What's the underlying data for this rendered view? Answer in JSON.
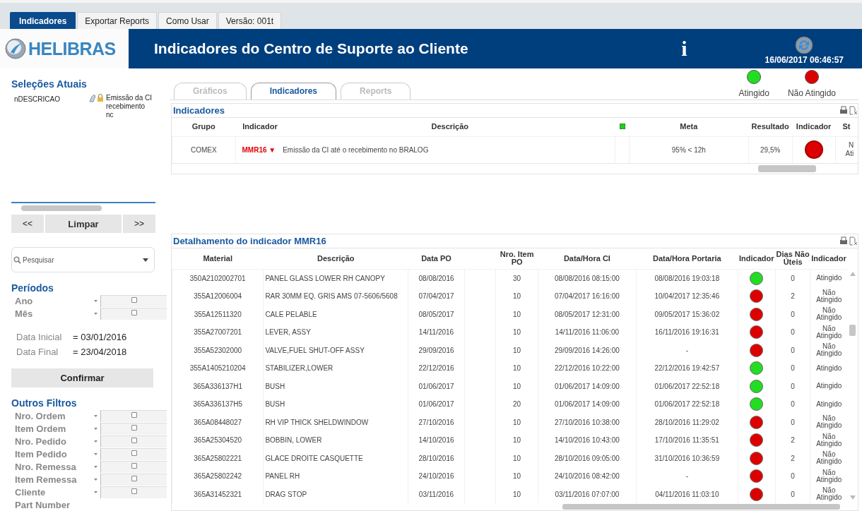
{
  "top_tabs": [
    {
      "label": "Indicadores",
      "selected": true
    },
    {
      "label": "Exportar Reports",
      "selected": false
    },
    {
      "label": "Como Usar",
      "selected": false
    },
    {
      "label": "Versão: 001t",
      "selected": false
    }
  ],
  "header": {
    "logo": "HELIBRAS",
    "title": "Indicadores do Centro de Suporte ao Cliente",
    "info": "i",
    "timestamp": "16/06/2017 06:46:57"
  },
  "sidebar": {
    "current_selections": {
      "title": "Seleções Atuais",
      "items": [
        {
          "field": "nDESCRICAO",
          "value": "Emissão da CI recebimento nc"
        }
      ]
    },
    "nav_buttons": [
      "<<",
      "Limpar",
      ">>"
    ],
    "search": {
      "placeholder": "Pesquisar"
    },
    "periods": {
      "title": "Períodos",
      "fields": [
        "Ano",
        "Mês"
      ]
    },
    "dates": [
      {
        "label": "Data Inicial",
        "value": "= 03/01/2016"
      },
      {
        "label": "Data Final",
        "value": "= 23/04/2018"
      }
    ],
    "confirm": "Confirmar",
    "other_filters": {
      "title": "Outros Filtros",
      "fields": [
        "Nro. Ordem",
        "Item Ordem",
        "Nro. Pedido",
        "Item Pedido",
        "Nro. Remessa",
        "Item Remessa",
        "Cliente"
      ],
      "trailing_label": "Part Number"
    }
  },
  "sub_tabs": [
    {
      "label": "Gráficos",
      "selected": false
    },
    {
      "label": "Indicadores",
      "selected": true
    },
    {
      "label": "Reports",
      "selected": false
    }
  ],
  "legend": [
    {
      "label": "Atingido",
      "color": "#22dd22"
    },
    {
      "label": "Não Atingido",
      "color": "#dd0000"
    }
  ],
  "indicators_table": {
    "title": "Indicadores",
    "columns": [
      {
        "kind": "text",
        "label": "Grupo"
      },
      {
        "kind": "text",
        "label": "Indicador"
      },
      {
        "kind": "text",
        "label": "Descrição"
      },
      {
        "kind": "marker",
        "color": "#22cc22"
      },
      {
        "kind": "text",
        "label": "Meta"
      },
      {
        "kind": "text",
        "label": "Resultado"
      },
      {
        "kind": "text",
        "label": "Indicador"
      },
      {
        "kind": "text",
        "label": "St"
      }
    ],
    "rows": [
      {
        "grupo": "COMEX",
        "indicador": "MMR16",
        "trend": "▼",
        "descricao": "Emissão da CI até o recebimento no BRALOG",
        "meta": "95% < 12h",
        "resultado": "29,5%",
        "color": "#dd0000",
        "status": "N Ati"
      }
    ]
  },
  "detail_table": {
    "title": "Detalhamento do indicador MMR16",
    "columns": [
      "Material",
      "Descrição",
      "Data PO",
      "Nro. Item PO",
      "Data/Hora CI",
      "Data/Hora Portaria",
      "Indicador",
      "Dias Não Úteis",
      "Indicador"
    ],
    "rows": [
      {
        "material": "350A2102002701",
        "descricao": "PANEL GLASS LOWER RH CANOPY",
        "data_po": "08/08/2016",
        "item_po": "30",
        "data_ci": "08/08/2016 08:15:00",
        "data_portaria": "08/08/2016 19:03:18",
        "color": "#22dd22",
        "dias": "0",
        "status": "Atingido"
      },
      {
        "material": "355A12006004",
        "descricao": "RAR 30MM EQ. GRIS AMS 07-5606/5608",
        "data_po": "07/04/2017",
        "item_po": "10",
        "data_ci": "07/04/2017 16:16:00",
        "data_portaria": "10/04/2017 12:35:46",
        "color": "#dd0000",
        "dias": "2",
        "status": "Não Atingido"
      },
      {
        "material": "355A12511320",
        "descricao": "CALE PELABLE",
        "data_po": "08/05/2017",
        "item_po": "10",
        "data_ci": "08/05/2017 12:31:00",
        "data_portaria": "09/05/2017 15:36:02",
        "color": "#dd0000",
        "dias": "0",
        "status": "Não Atingido"
      },
      {
        "material": "355A27007201",
        "descricao": "LEVER, ASSY",
        "data_po": "14/11/2016",
        "item_po": "10",
        "data_ci": "14/11/2016 11:06:00",
        "data_portaria": "16/11/2016 19:16:31",
        "color": "#dd0000",
        "dias": "0",
        "status": "Não Atingido"
      },
      {
        "material": "355A52302000",
        "descricao": "VALVE,FUEL SHUT-OFF ASSY",
        "data_po": "29/09/2016",
        "item_po": "10",
        "data_ci": "29/09/2016 14:26:00",
        "data_portaria": "-",
        "color": "#dd0000",
        "dias": "0",
        "status": "Não Atingido"
      },
      {
        "material": "355A1405210204",
        "descricao": "STABILIZER,LOWER",
        "data_po": "22/12/2016",
        "item_po": "10",
        "data_ci": "22/12/2016 10:22:00",
        "data_portaria": "22/12/2016 19:42:57",
        "color": "#22dd22",
        "dias": "0",
        "status": "Atingido"
      },
      {
        "material": "365A336137H1",
        "descricao": "BUSH",
        "data_po": "01/06/2017",
        "item_po": "10",
        "data_ci": "01/06/2017 14:09:00",
        "data_portaria": "01/06/2017 22:52:18",
        "color": "#22dd22",
        "dias": "0",
        "status": "Atingido"
      },
      {
        "material": "365A336137H5",
        "descricao": "BUSH",
        "data_po": "01/06/2017",
        "item_po": "20",
        "data_ci": "01/06/2017 14:09:00",
        "data_portaria": "01/06/2017 22:52:18",
        "color": "#22dd22",
        "dias": "0",
        "status": "Atingido"
      },
      {
        "material": "365A08448027",
        "descricao": "RH VIP THICK SHELDWINDOW",
        "data_po": "27/10/2016",
        "item_po": "10",
        "data_ci": "27/10/2016 10:38:00",
        "data_portaria": "28/10/2016 11:29:02",
        "color": "#dd0000",
        "dias": "0",
        "status": "Não Atingido"
      },
      {
        "material": "365A25304520",
        "descricao": "BOBBIN, LOWER",
        "data_po": "14/10/2016",
        "item_po": "10",
        "data_ci": "14/10/2016 10:43:00",
        "data_portaria": "17/10/2016 11:35:51",
        "color": "#dd0000",
        "dias": "2",
        "status": "Não Atingido"
      },
      {
        "material": "365A25802221",
        "descricao": "GLACE DROITE CASQUETTE",
        "data_po": "28/10/2016",
        "item_po": "10",
        "data_ci": "28/10/2016 09:05:00",
        "data_portaria": "31/10/2016 10:36:59",
        "color": "#dd0000",
        "dias": "2",
        "status": "Não Atingido"
      },
      {
        "material": "365A25802242",
        "descricao": "PANEL RH",
        "data_po": "24/10/2016",
        "item_po": "10",
        "data_ci": "24/10/2016 08:42:00",
        "data_portaria": "-",
        "color": "#dd0000",
        "dias": "0",
        "status": "Não Atingido"
      },
      {
        "material": "365A31452321",
        "descricao": "DRAG STOP",
        "data_po": "03/11/2016",
        "item_po": "10",
        "data_ci": "03/11/2016 07:07:00",
        "data_portaria": "04/11/2016 11:03:10",
        "color": "#dd0000",
        "dias": "0",
        "status": "Não Atingido"
      }
    ]
  }
}
